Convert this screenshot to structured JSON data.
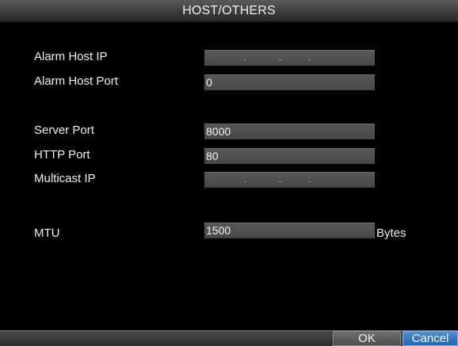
{
  "dialog": {
    "title": "HOST/OTHERS"
  },
  "fields": {
    "alarm_host_ip": {
      "label": "Alarm Host IP",
      "value": ""
    },
    "alarm_host_port": {
      "label": "Alarm Host Port",
      "value": "0"
    },
    "server_port": {
      "label": "Server Port",
      "value": "8000"
    },
    "http_port": {
      "label": "HTTP Port",
      "value": "80"
    },
    "multicast_ip": {
      "label": "Multicast IP",
      "value": ""
    },
    "mtu": {
      "label": "MTU",
      "value": "1500",
      "unit": "Bytes"
    }
  },
  "ip_separator": ".",
  "buttons": {
    "ok": "OK",
    "cancel": "Cancel"
  },
  "colors": {
    "background": "#000000",
    "field": "#4f4f4f",
    "selected_button": "#2f74be"
  }
}
